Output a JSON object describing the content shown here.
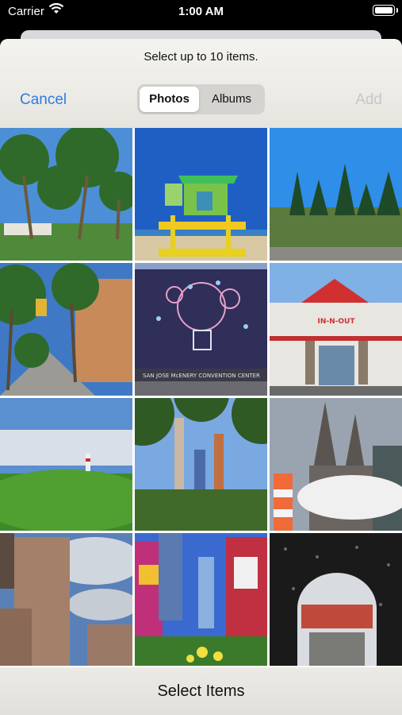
{
  "status_bar": {
    "carrier": "Carrier",
    "time": "1:00 AM"
  },
  "picker": {
    "prompt": "Select up to 10 items.",
    "cancel_label": "Cancel",
    "add_label": "Add",
    "segments": [
      "Photos",
      "Albums"
    ],
    "selected_segment": "Photos"
  },
  "photos": [
    {
      "subject": "palm-trees"
    },
    {
      "subject": "lifeguard-tower"
    },
    {
      "subject": "pine-trees"
    },
    {
      "subject": "street-with-trees"
    },
    {
      "subject": "convention-center-mural",
      "caption": "SAN JOSE McENERY CONVENTION CENTER"
    },
    {
      "subject": "in-n-out-store",
      "sign": "IN-N-OUT"
    },
    {
      "subject": "lighthouse-field"
    },
    {
      "subject": "city-skyline-trees"
    },
    {
      "subject": "cathedral-steam"
    },
    {
      "subject": "tall-building-clouds"
    },
    {
      "subject": "times-square"
    },
    {
      "subject": "rainy-windshield-arch"
    }
  ],
  "footer": {
    "label": "Select Items"
  }
}
